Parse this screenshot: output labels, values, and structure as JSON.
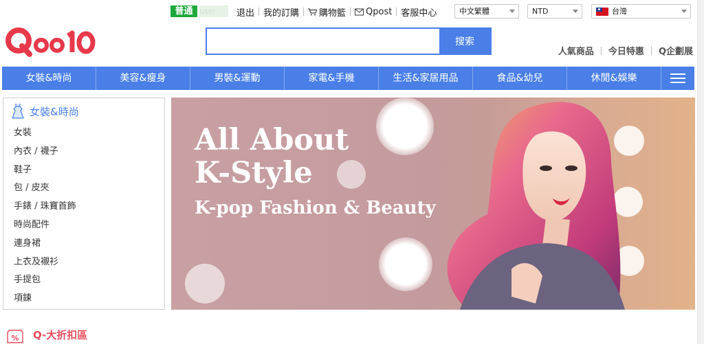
{
  "topbar": {
    "grade_badge": "普通",
    "user_name": "user",
    "links": {
      "logout": "退出",
      "my_orders": "我的訂購",
      "cart": "購物籃",
      "qpost": "Qpost",
      "customer_service": "客服中心"
    },
    "language_select": "中文繁體",
    "currency_select": "NTD",
    "region_select": "台灣"
  },
  "header": {
    "logo_text": "Qoo10",
    "search": {
      "value": "",
      "placeholder": "",
      "button_label": "搜索"
    },
    "links": [
      "人氣商品",
      "今日特惠",
      "Q企劃展"
    ]
  },
  "category_nav": {
    "items": [
      "女裝&時尚",
      "美容&瘦身",
      "男裝&運動",
      "家電&手機",
      "生活&家居用品",
      "食品&幼兒",
      "休閒&娛樂"
    ],
    "menu_icon": "hamburger-menu-icon"
  },
  "sidebar": {
    "title": "女裝&時尚",
    "icon": "dress-icon",
    "items": [
      "女裝",
      "內衣 / 襪子",
      "鞋子",
      "包 / 皮夾",
      "手錶 / 珠寶首飾",
      "時尚配件",
      "連身裙",
      "上衣及襯衫",
      "手提包",
      "項鍊"
    ]
  },
  "banner": {
    "headline_line1": "All About",
    "headline_line2": "K-Style",
    "subheadline": "K-pop Fashion & Beauty"
  },
  "discount_section": {
    "title": "Q-大折扣區",
    "icon": "discount-percent-icon"
  },
  "colors": {
    "brand_blue": "#4a7fe8",
    "logo_red": "#e8394a",
    "grade_green": "#1fa83c",
    "discount_red": "#e84b5c"
  }
}
